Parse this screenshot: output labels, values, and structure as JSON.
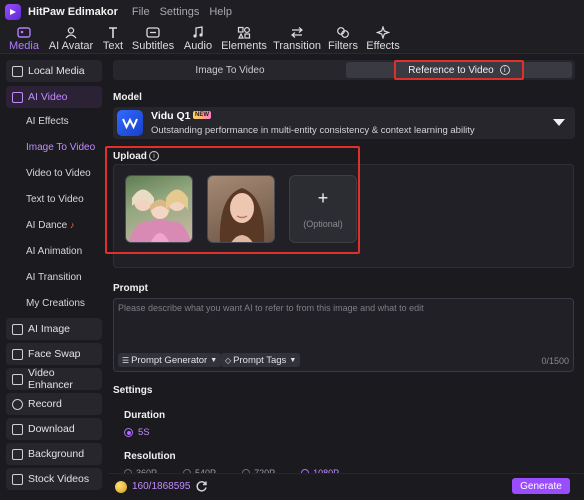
{
  "window": {
    "title": "HitPaw Edimakor"
  },
  "menubar": {
    "items": [
      "File",
      "Settings",
      "Help"
    ]
  },
  "toolbar": {
    "items": [
      "Media",
      "AI Avatar",
      "Text",
      "Subtitles",
      "Audio",
      "Elements",
      "Transition",
      "Filters",
      "Effects"
    ],
    "active": "Media"
  },
  "sidebar": {
    "sections": [
      "Local Media",
      "AI Video",
      "AI Image",
      "Face Swap",
      "Video Enhancer",
      "Record",
      "Download",
      "Background",
      "Stock Videos"
    ],
    "sub_items": [
      "AI Effects",
      "Image To Video",
      "Video to Video",
      "Text to Video",
      "AI Dance",
      "AI Animation",
      "AI Transition",
      "My Creations"
    ],
    "active_section": "AI Video",
    "active_sub": "Image To Video"
  },
  "tabs": [
    "Image To Video",
    "Reference to Video"
  ],
  "active_tab": "Reference to Video",
  "model": {
    "heading": "Model",
    "name": "Vidu Q1",
    "badge": "NEW",
    "description": "Outstanding performance in multi-entity consistency & context learning ability"
  },
  "upload": {
    "heading": "Upload",
    "add_symbol": "+",
    "optional_label": "(Optional)"
  },
  "prompt": {
    "heading": "Prompt",
    "placeholder": "Please describe what you want AI to refer to from this image and what to edit",
    "generator_label": "Prompt Generator",
    "tags_label": "Prompt Tags",
    "counter": "0/1500"
  },
  "settings": {
    "heading": "Settings",
    "duration_label": "Duration",
    "duration_value": "5S",
    "resolution_label": "Resolution",
    "resolution_options": [
      "360P",
      "540P",
      "720P",
      "1080P"
    ],
    "resolution_selected": "1080P"
  },
  "footer": {
    "credits": "160/1868595",
    "generate_label": "Generate"
  },
  "colors": {
    "accent": "#9a4dff",
    "highlight": "#e0302a",
    "background": "#1a1a1f"
  }
}
